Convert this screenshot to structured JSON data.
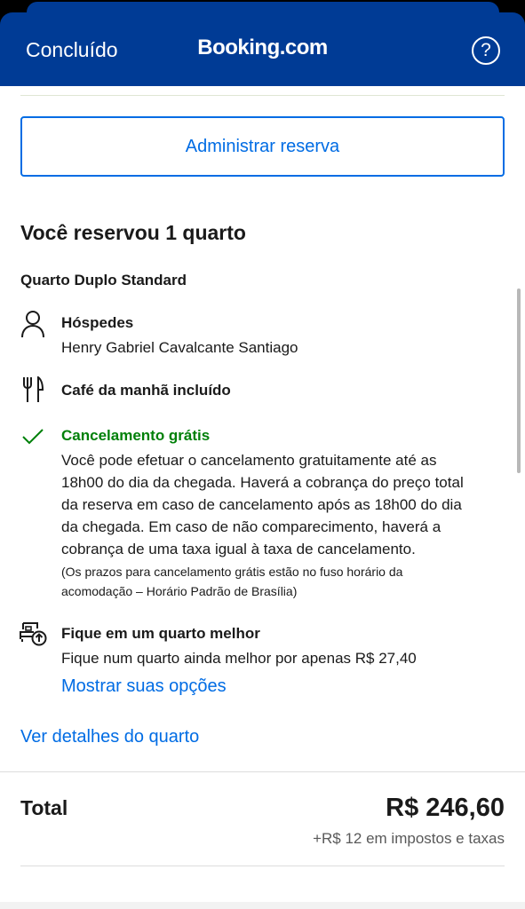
{
  "header": {
    "done_label": "Concluído",
    "logo_text": "Booking.com",
    "help_symbol": "?",
    "color": "#003b95"
  },
  "manage_button": {
    "label": "Administrar reserva"
  },
  "booking": {
    "title": "Você reservou 1 quarto",
    "room_name": "Quarto Duplo Standard",
    "guests": {
      "icon": "person-icon",
      "title": "Hóspedes",
      "name": "Henry Gabriel Cavalcante Santiago"
    },
    "breakfast": {
      "icon": "fork-knife-icon",
      "title": "Café da manhã incluído"
    },
    "cancellation": {
      "icon": "checkmark-icon",
      "title": "Cancelamento grátis",
      "lines": [
        "Você pode efetuar o cancelamento gratuitamente até as",
        "18h00 do dia da chegada. Haverá a cobrança do preço total",
        "da reserva em caso de cancelamento após as 18h00 do dia",
        "da chegada. Em caso de não comparecimento, haverá a",
        "cobrança de uma taxa igual à taxa de cancelamento."
      ],
      "note_lines": [
        "(Os prazos para cancelamento grátis estão no fuso horário da",
        "acomodação – Horário Padrão de Brasília)"
      ],
      "color": "#008009"
    },
    "upgrade": {
      "icon": "bed-upgrade-icon",
      "title": "Fique em um quarto melhor",
      "text": "Fique num quarto ainda melhor por apenas R$ 27,40",
      "link": "Mostrar suas opções"
    },
    "room_details_link": "Ver detalhes do quarto"
  },
  "total": {
    "label": "Total",
    "price": "R$ 246,60",
    "taxes": "+R$ 12 em impostos e taxas"
  },
  "link_color": "#006ce4"
}
